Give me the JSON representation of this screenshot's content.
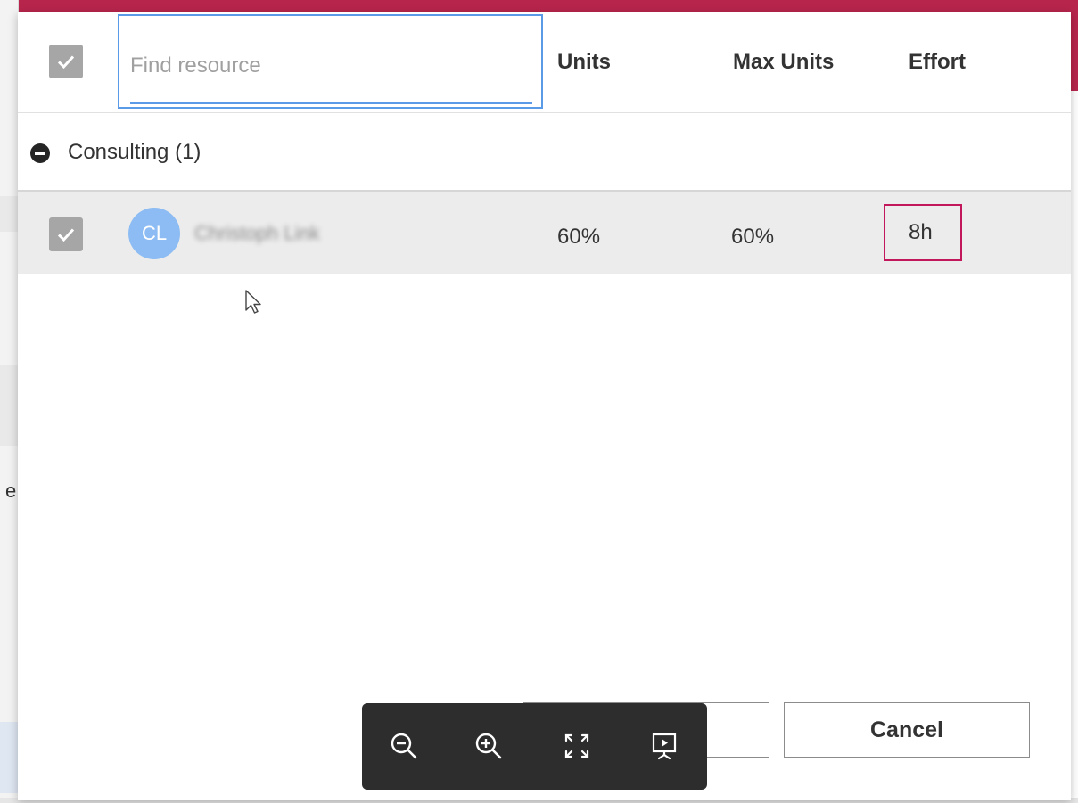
{
  "search": {
    "placeholder": "Find resource",
    "value": ""
  },
  "columns": {
    "units": "Units",
    "max_units": "Max Units",
    "effort": "Effort"
  },
  "group": {
    "label": "Consulting (1)"
  },
  "resource": {
    "initials": "CL",
    "name": "Christoph Link",
    "units": "60%",
    "max_units": "60%",
    "effort": "8h"
  },
  "buttons": {
    "ok": "",
    "cancel": "Cancel"
  },
  "background": {
    "partial_letter": "e"
  },
  "viewer_toolbar": {
    "icons": [
      "zoom-out-icon",
      "zoom-in-icon",
      "fullscreen-icon",
      "presentation-icon"
    ]
  },
  "colors": {
    "accent_blue": "#5b9ae6",
    "avatar": "#8cbcf3",
    "highlight_box": "#c2185b",
    "header_bar": "#b8254c"
  }
}
